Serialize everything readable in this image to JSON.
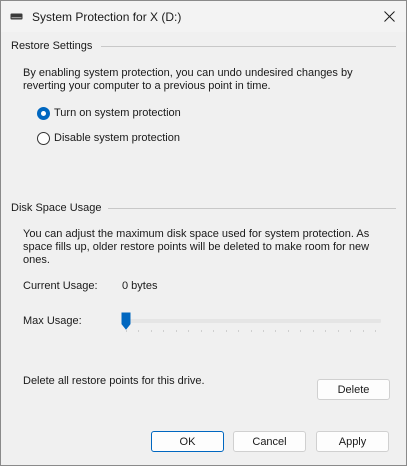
{
  "window": {
    "title": "System Protection for X (D:)"
  },
  "icons": {
    "title_icon": "drive-icon",
    "close": "close-icon"
  },
  "restore_settings": {
    "title": "Restore Settings",
    "description": "By enabling system protection, you can undo undesired changes by reverting your computer to a previous point in time.",
    "options": [
      {
        "label": "Turn on system protection",
        "checked": true
      },
      {
        "label": "Disable system protection",
        "checked": false
      }
    ]
  },
  "disk_space": {
    "title": "Disk Space Usage",
    "description": "You can adjust the maximum disk space used for system protection. As space fills up, older restore points will be deleted to make room for new ones.",
    "current_usage_label": "Current Usage:",
    "current_usage_value": "0 bytes",
    "max_usage_label": "Max Usage:",
    "max_usage_fraction": 0
  },
  "delete_section": {
    "text": "Delete all restore points for this drive.",
    "button_label": "Delete"
  },
  "footer": {
    "ok_label": "OK",
    "cancel_label": "Cancel",
    "apply_label": "Apply"
  },
  "colors": {
    "accent": "#0067c0",
    "background": "#f0f0f0"
  }
}
